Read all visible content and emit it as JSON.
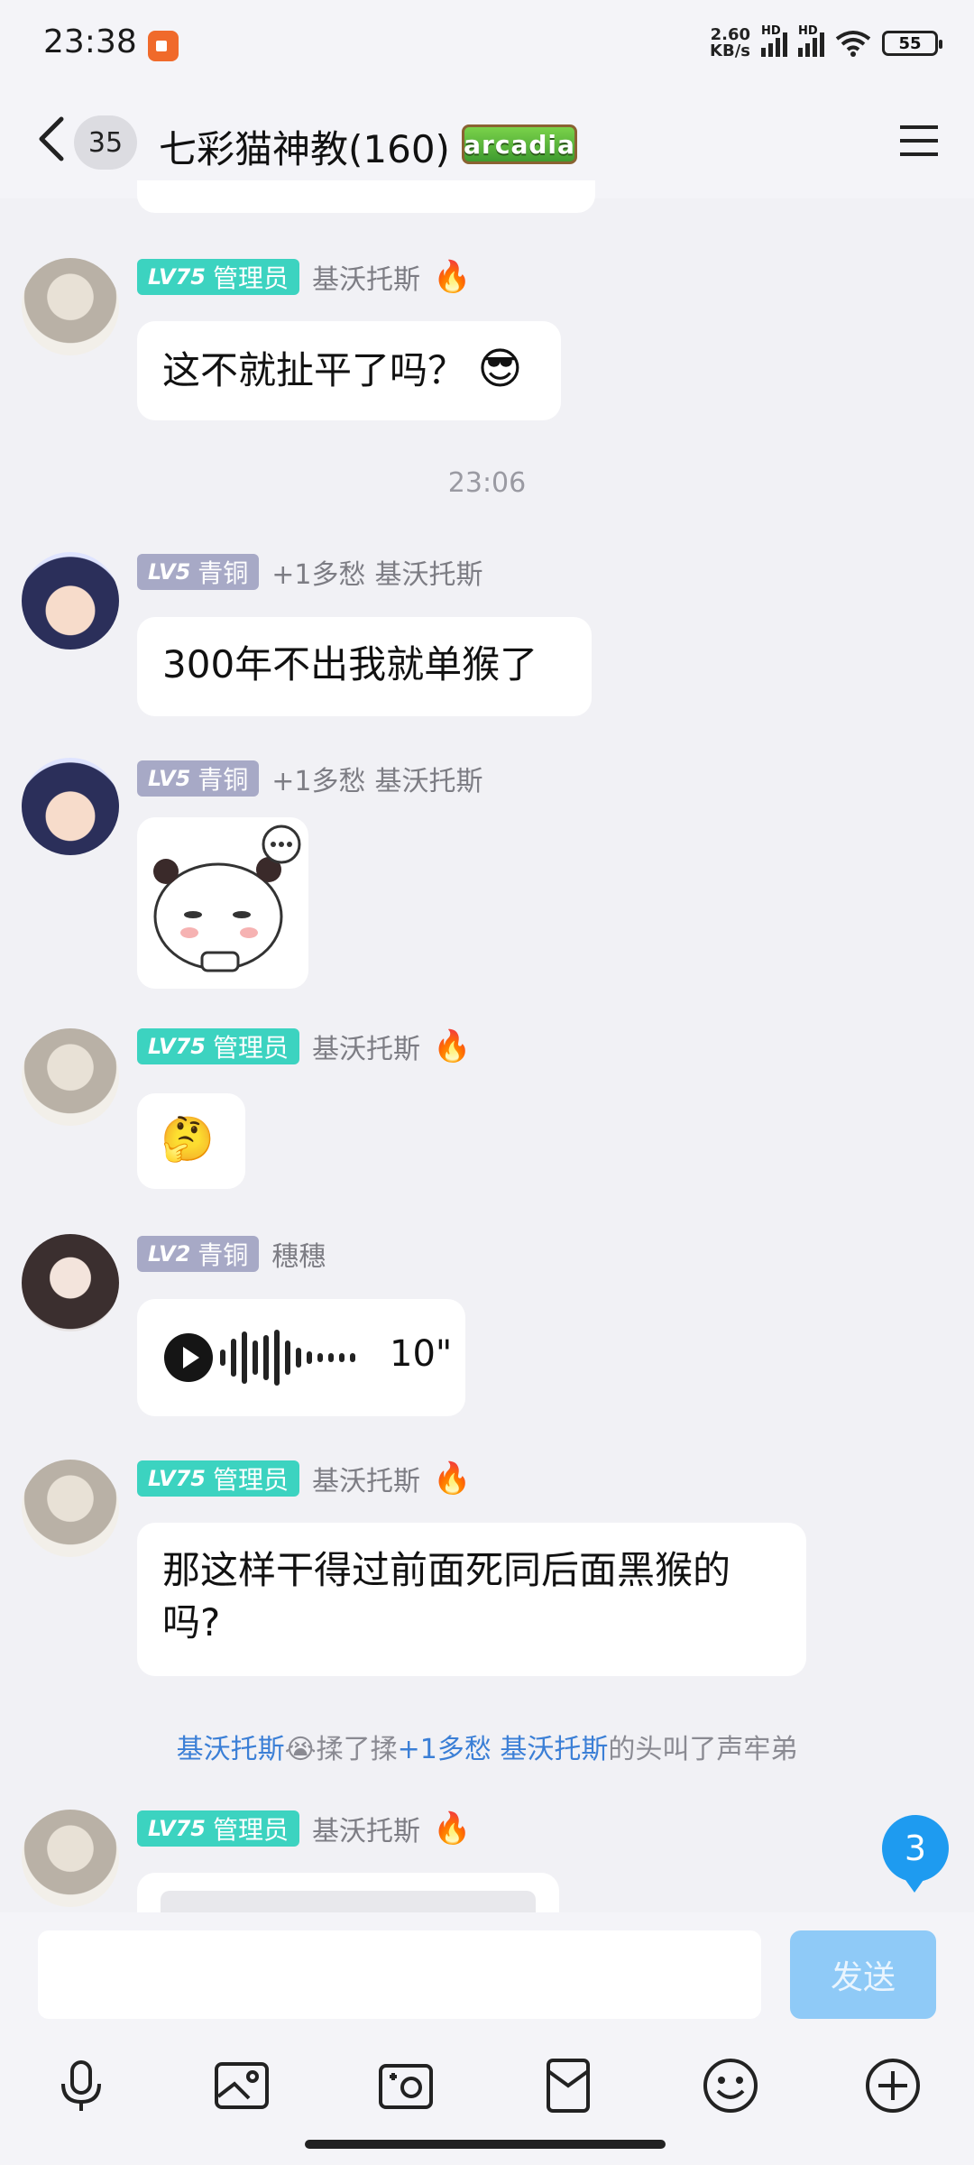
{
  "status_bar": {
    "time": "23:38",
    "net_speed_top": "2.60",
    "net_speed_bottom": "KB/s",
    "hd1": "HD",
    "hd2": "HD",
    "battery": "55"
  },
  "header": {
    "unread_count": "35",
    "title": "七彩猫神教(160)",
    "badge_text": "arcadia"
  },
  "messages": [
    {
      "level": "LV75",
      "role": "管理员",
      "nick": "基沃托斯",
      "text": "这不就扯平了吗？",
      "emoji": "😎"
    },
    {
      "time": "23:06"
    },
    {
      "level": "LV5",
      "role": "青铜",
      "title": "+1多愁",
      "nick": "基沃托斯",
      "text": "300年不出我就单猴了"
    },
    {
      "level": "LV5",
      "role": "青铜",
      "title": "+1多愁",
      "nick": "基沃托斯",
      "sticker": "panda-sticker"
    },
    {
      "level": "LV75",
      "role": "管理员",
      "nick": "基沃托斯",
      "emoji": "🤔"
    },
    {
      "level": "LV2",
      "role": "青铜",
      "nick": "穗穗",
      "voice_duration": "10\""
    },
    {
      "level": "LV75",
      "role": "管理员",
      "nick": "基沃托斯",
      "text_line1": "那这样干得过前面死同后面黑猴的",
      "text_line2": "吗?"
    },
    {
      "system": {
        "actor": "基沃托斯",
        "actor_emoji": "😭",
        "action": "揉了揉",
        "target_title": "+1多愁",
        "target": "基沃托斯",
        "suffix": "的头叫了声牢弟"
      }
    },
    {
      "level": "LV75",
      "role": "管理员",
      "nick": "基沃托斯"
    }
  ],
  "float_badge": "3",
  "input": {
    "placeholder": "",
    "send_label": "发送"
  },
  "toolbar": [
    "mic-icon",
    "image-icon",
    "camera-icon",
    "red-packet-icon",
    "emoji-icon",
    "plus-icon"
  ],
  "colors": {
    "admin_tag": "#3cd3c0",
    "bronze_tag": "#a7a9c6",
    "send_button": "#8fcaf7",
    "link": "#3b7fd6"
  }
}
